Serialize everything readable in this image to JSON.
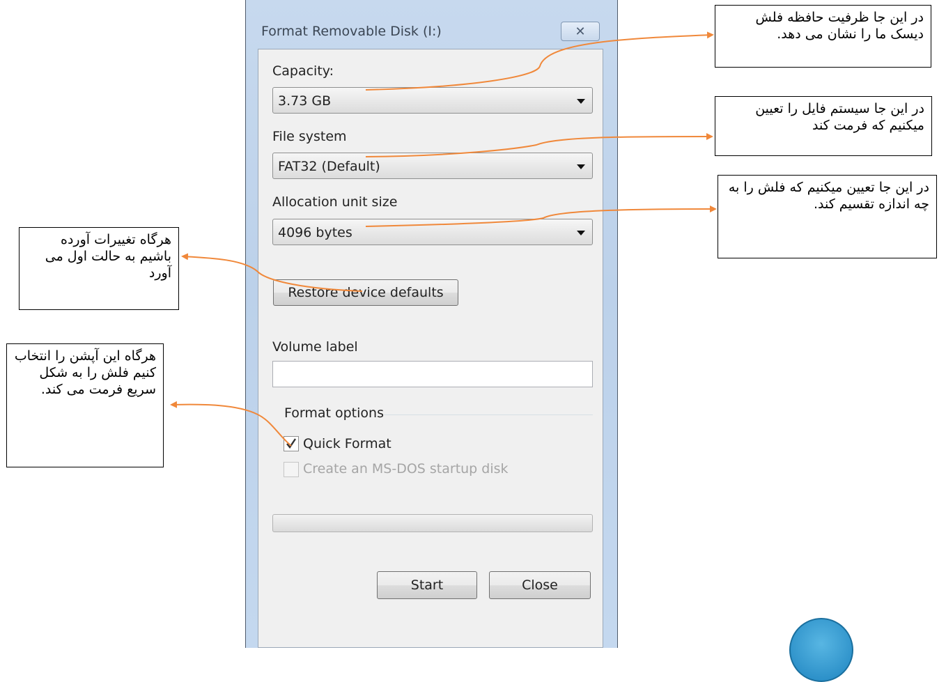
{
  "window": {
    "title": "Format Removable Disk (I:)",
    "close_glyph": "✕"
  },
  "capacity": {
    "label": "Capacity:",
    "value": "3.73 GB"
  },
  "file_system": {
    "label": "File system",
    "value": "FAT32 (Default)"
  },
  "allocation": {
    "label": "Allocation unit size",
    "value": "4096 bytes"
  },
  "restore_button": "Restore device defaults",
  "volume_label": {
    "label": "Volume label",
    "value": ""
  },
  "format_options": {
    "title": "Format options",
    "quick_format": {
      "label": "Quick Format",
      "checked": true
    },
    "msdos": {
      "label": "Create an MS-DOS startup disk",
      "checked": false,
      "enabled": false
    }
  },
  "progress": {
    "value": 0
  },
  "buttons": {
    "start": "Start",
    "close": "Close"
  },
  "annotations": {
    "capacity": "در این جا ظرفیت حافظه فلش دیسک ما را نشان می دهد.",
    "file_system": "در این جا سیستم فایل را تعیین میکنیم که فرمت کند",
    "allocation": "در این جا تعیین میکنیم که فلش را به چه اندازه تقسیم کند.",
    "restore": "هرگاه تغییرات آورده باشیم به حالت اول می آورد",
    "quick_format": "هرگاه این آپشن را انتخاب کنیم فلش را به شکل سریع فرمت می کند."
  },
  "colors": {
    "arrow": "#f0883a",
    "window_frame": "#c7d9ee",
    "client": "#f0f0f0"
  }
}
